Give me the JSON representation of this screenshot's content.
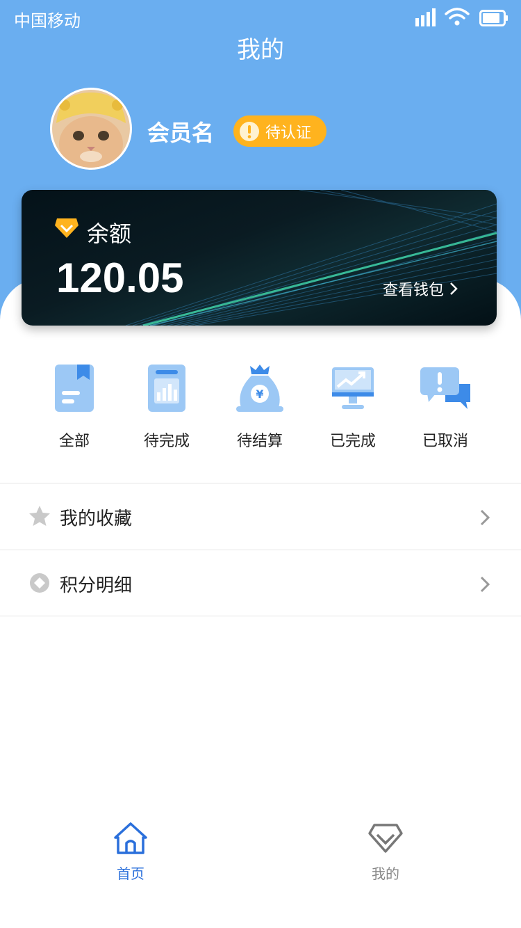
{
  "status_bar": {
    "carrier": "中国移动"
  },
  "header": {
    "title": "我的"
  },
  "profile": {
    "name": "会员名",
    "badge": "待认证"
  },
  "wallet_card": {
    "label": "余额",
    "amount": "120.05",
    "link": "查看钱包"
  },
  "orders": [
    {
      "label": "全部",
      "icon": "book-icon"
    },
    {
      "label": "待完成",
      "icon": "clipboard-chart-icon"
    },
    {
      "label": "待结算",
      "icon": "money-bag-icon"
    },
    {
      "label": "已完成",
      "icon": "monitor-trend-icon"
    },
    {
      "label": "已取消",
      "icon": "chat-alert-icon"
    }
  ],
  "menu": [
    {
      "label": "我的收藏",
      "icon": "star-icon"
    },
    {
      "label": "积分明细",
      "icon": "points-icon"
    }
  ],
  "tabbar": [
    {
      "label": "首页",
      "icon": "home-icon",
      "active": true,
      "color": "#2a6fdb"
    },
    {
      "label": "我的",
      "icon": "diamond-icon",
      "active": false,
      "color": "#888888"
    }
  ]
}
